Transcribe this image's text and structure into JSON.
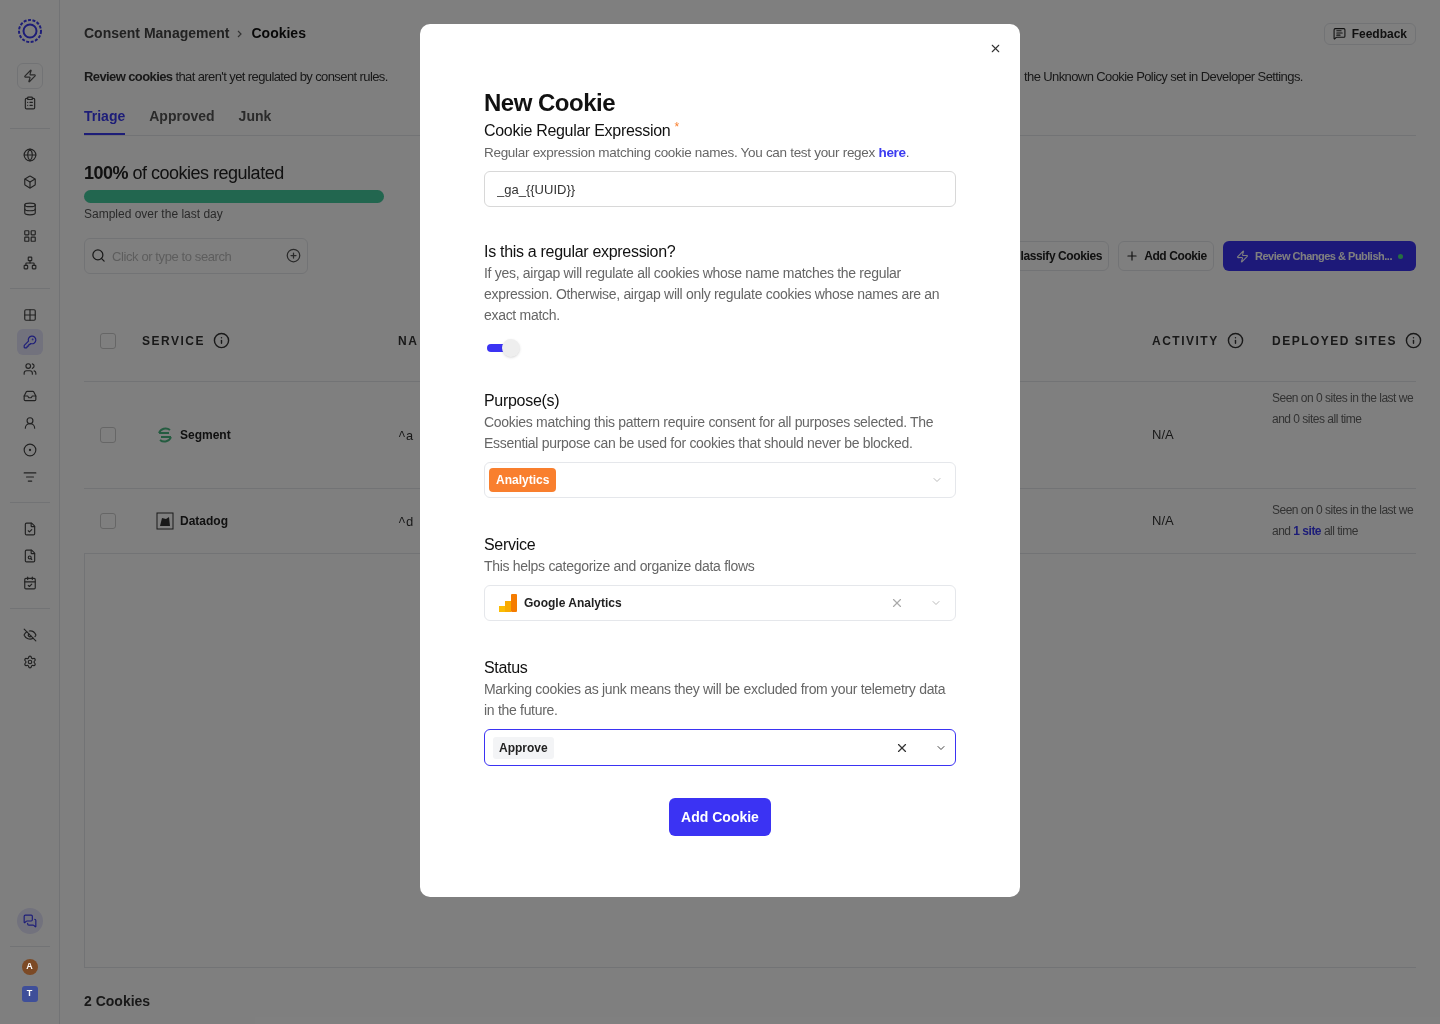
{
  "sidebar": {
    "items": [
      {
        "selected": false
      },
      {
        "selected": false
      },
      {
        "selected": false
      },
      {
        "selected": false
      },
      {
        "selected": false
      },
      {
        "selected": false
      },
      {
        "selected": false
      },
      {
        "selected": false
      },
      {
        "selected": true
      },
      {
        "selected": false
      },
      {
        "selected": false
      },
      {
        "selected": false
      },
      {
        "selected": false
      },
      {
        "selected": false
      },
      {
        "selected": false
      },
      {
        "selected": false
      },
      {
        "selected": false
      },
      {
        "selected": false
      },
      {
        "selected": false
      }
    ],
    "chat_selected": true,
    "avatars": [
      {
        "text": "A",
        "color": "#7c4a26"
      },
      {
        "text": "T",
        "color": "#3f4f99"
      }
    ]
  },
  "breadcrumb": [
    "Consent Management",
    "Cookies"
  ],
  "feedback_button": "Feedback",
  "description_left": "**Review cookies** that aren't yet regulated by consent rules.",
  "description_right": "the Unknown Cookie Policy set in Developer Settings.",
  "tabs": [
    {
      "label": "Triage",
      "selected": true
    },
    {
      "label": "Approved",
      "selected": false
    },
    {
      "label": "Junk",
      "selected": false
    }
  ],
  "regulated": {
    "title": "**100%** of cookies regulated",
    "level": 1,
    "caption": "Sampled over the last day"
  },
  "search": {
    "placeholder": "Click or type to search"
  },
  "toolbar": [
    {
      "label": "lassify Cookies",
      "kind": "plain"
    },
    {
      "label": "Add Cookie",
      "kind": "add"
    },
    {
      "label": "Review Changes & Publish...",
      "kind": "primary"
    }
  ],
  "table": {
    "select_all_checked": false,
    "columns": [
      "SERVICE",
      "NA",
      "ACTIVITY",
      "DEPLOYED SITES"
    ],
    "rows": [
      {
        "checked": false,
        "service": "Segment",
        "name": "^a",
        "activity": "N/A",
        "deployed_line1": "Seen on 0 sites in the last we",
        "deployed_line2": [
          {
            "kind": "text",
            "text": "and 0 sites all time"
          }
        ]
      },
      {
        "checked": false,
        "service": "Datadog",
        "name": "^d",
        "activity": "N/A",
        "deployed_line1": "Seen on 0 sites in the last we",
        "deployed_line2": [
          {
            "kind": "text",
            "text": "and "
          },
          {
            "kind": "link",
            "text": "1 site"
          },
          {
            "kind": "text",
            "text": " all time"
          }
        ]
      }
    ]
  },
  "footer": "2 Cookies",
  "modal": {
    "title": "New Cookie",
    "regex": {
      "label": "Cookie Regular Expression",
      "required_mark": "*",
      "hint": "Regular expression matching cookie names. You can test your regex ",
      "hint_link": "here",
      "hint_end": ".",
      "value": "_ga_{{UUID}}"
    },
    "regex_toggle": {
      "label": "Is this a regular expression?",
      "description": "If yes, airgap will regulate all cookies whose name matches the regular expression. Otherwise, airgap will only regulate cookies whose names are an exact match.",
      "on": true
    },
    "purposes": {
      "label": "Purpose(s)",
      "description": "Cookies matching this pattern require consent for all purposes selected. The Essential purpose can be used for cookies that should never be blocked.",
      "tags": [
        {
          "text": "Analytics",
          "color": "#f97f2e"
        }
      ]
    },
    "service": {
      "label": "Service",
      "description": "This helps categorize and organize data flows",
      "value": "Google Analytics"
    },
    "status": {
      "label": "Status",
      "description": "Marking cookies as junk means they will be excluded from your telemetry data in the future.",
      "value": "Approve",
      "focused": true
    },
    "submit": "Add Cookie"
  }
}
